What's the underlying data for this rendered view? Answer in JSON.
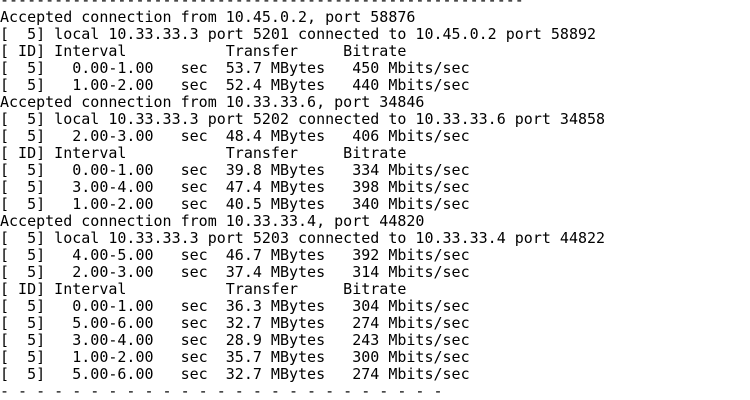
{
  "terminal": {
    "lines": [
      "----------------------------------------------------------",
      "Accepted connection from 10.45.0.2, port 58876",
      "[  5] local 10.33.33.3 port 5201 connected to 10.45.0.2 port 58892",
      "[ ID] Interval           Transfer     Bitrate",
      "[  5]   0.00-1.00   sec  53.7 MBytes   450 Mbits/sec",
      "[  5]   1.00-2.00   sec  52.4 MBytes   440 Mbits/sec",
      "Accepted connection from 10.33.33.6, port 34846",
      "[  5] local 10.33.33.3 port 5202 connected to 10.33.33.6 port 34858",
      "[  5]   2.00-3.00   sec  48.4 MBytes   406 Mbits/sec",
      "[ ID] Interval           Transfer     Bitrate",
      "[  5]   0.00-1.00   sec  39.8 MBytes   334 Mbits/sec",
      "[  5]   3.00-4.00   sec  47.4 MBytes   398 Mbits/sec",
      "[  5]   1.00-2.00   sec  40.5 MBytes   340 Mbits/sec",
      "Accepted connection from 10.33.33.4, port 44820",
      "[  5] local 10.33.33.3 port 5203 connected to 10.33.33.4 port 44822",
      "[  5]   4.00-5.00   sec  46.7 MBytes   392 Mbits/sec",
      "[  5]   2.00-3.00   sec  37.4 MBytes   314 Mbits/sec",
      "[ ID] Interval           Transfer     Bitrate",
      "[  5]   0.00-1.00   sec  36.3 MBytes   304 Mbits/sec",
      "[  5]   5.00-6.00   sec  32.7 MBytes   274 Mbits/sec",
      "[  5]   3.00-4.00   sec  28.9 MBytes   243 Mbits/sec",
      "[  5]   1.00-2.00   sec  35.7 MBytes   300 Mbits/sec",
      "[  5]   5.00-6.00   sec  32.7 MBytes   274 Mbits/sec",
      "- - - - - - - - - - - - - - - - - - - - - - - - -"
    ]
  }
}
